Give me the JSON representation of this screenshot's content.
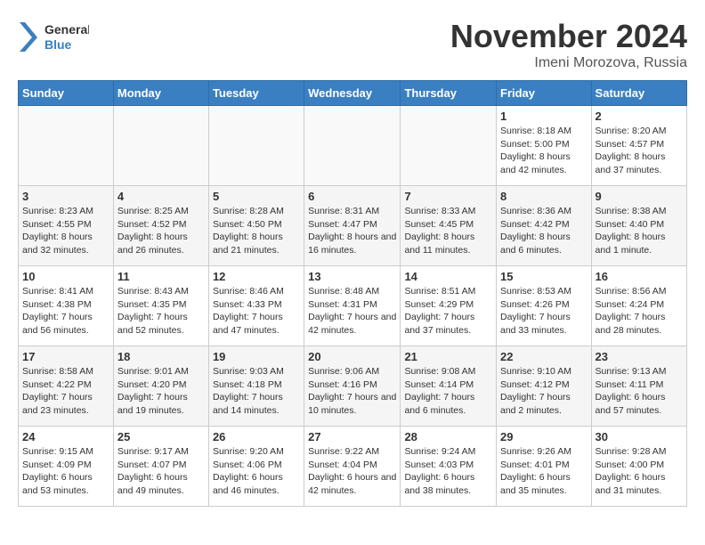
{
  "header": {
    "logo_general": "General",
    "logo_blue": "Blue",
    "month_title": "November 2024",
    "subtitle": "Imeni Morozova, Russia"
  },
  "weekdays": [
    "Sunday",
    "Monday",
    "Tuesday",
    "Wednesday",
    "Thursday",
    "Friday",
    "Saturday"
  ],
  "weeks": [
    [
      {
        "day": "",
        "info": ""
      },
      {
        "day": "",
        "info": ""
      },
      {
        "day": "",
        "info": ""
      },
      {
        "day": "",
        "info": ""
      },
      {
        "day": "",
        "info": ""
      },
      {
        "day": "1",
        "info": "Sunrise: 8:18 AM\nSunset: 5:00 PM\nDaylight: 8 hours and 42 minutes."
      },
      {
        "day": "2",
        "info": "Sunrise: 8:20 AM\nSunset: 4:57 PM\nDaylight: 8 hours and 37 minutes."
      }
    ],
    [
      {
        "day": "3",
        "info": "Sunrise: 8:23 AM\nSunset: 4:55 PM\nDaylight: 8 hours and 32 minutes."
      },
      {
        "day": "4",
        "info": "Sunrise: 8:25 AM\nSunset: 4:52 PM\nDaylight: 8 hours and 26 minutes."
      },
      {
        "day": "5",
        "info": "Sunrise: 8:28 AM\nSunset: 4:50 PM\nDaylight: 8 hours and 21 minutes."
      },
      {
        "day": "6",
        "info": "Sunrise: 8:31 AM\nSunset: 4:47 PM\nDaylight: 8 hours and 16 minutes."
      },
      {
        "day": "7",
        "info": "Sunrise: 8:33 AM\nSunset: 4:45 PM\nDaylight: 8 hours and 11 minutes."
      },
      {
        "day": "8",
        "info": "Sunrise: 8:36 AM\nSunset: 4:42 PM\nDaylight: 8 hours and 6 minutes."
      },
      {
        "day": "9",
        "info": "Sunrise: 8:38 AM\nSunset: 4:40 PM\nDaylight: 8 hours and 1 minute."
      }
    ],
    [
      {
        "day": "10",
        "info": "Sunrise: 8:41 AM\nSunset: 4:38 PM\nDaylight: 7 hours and 56 minutes."
      },
      {
        "day": "11",
        "info": "Sunrise: 8:43 AM\nSunset: 4:35 PM\nDaylight: 7 hours and 52 minutes."
      },
      {
        "day": "12",
        "info": "Sunrise: 8:46 AM\nSunset: 4:33 PM\nDaylight: 7 hours and 47 minutes."
      },
      {
        "day": "13",
        "info": "Sunrise: 8:48 AM\nSunset: 4:31 PM\nDaylight: 7 hours and 42 minutes."
      },
      {
        "day": "14",
        "info": "Sunrise: 8:51 AM\nSunset: 4:29 PM\nDaylight: 7 hours and 37 minutes."
      },
      {
        "day": "15",
        "info": "Sunrise: 8:53 AM\nSunset: 4:26 PM\nDaylight: 7 hours and 33 minutes."
      },
      {
        "day": "16",
        "info": "Sunrise: 8:56 AM\nSunset: 4:24 PM\nDaylight: 7 hours and 28 minutes."
      }
    ],
    [
      {
        "day": "17",
        "info": "Sunrise: 8:58 AM\nSunset: 4:22 PM\nDaylight: 7 hours and 23 minutes."
      },
      {
        "day": "18",
        "info": "Sunrise: 9:01 AM\nSunset: 4:20 PM\nDaylight: 7 hours and 19 minutes."
      },
      {
        "day": "19",
        "info": "Sunrise: 9:03 AM\nSunset: 4:18 PM\nDaylight: 7 hours and 14 minutes."
      },
      {
        "day": "20",
        "info": "Sunrise: 9:06 AM\nSunset: 4:16 PM\nDaylight: 7 hours and 10 minutes."
      },
      {
        "day": "21",
        "info": "Sunrise: 9:08 AM\nSunset: 4:14 PM\nDaylight: 7 hours and 6 minutes."
      },
      {
        "day": "22",
        "info": "Sunrise: 9:10 AM\nSunset: 4:12 PM\nDaylight: 7 hours and 2 minutes."
      },
      {
        "day": "23",
        "info": "Sunrise: 9:13 AM\nSunset: 4:11 PM\nDaylight: 6 hours and 57 minutes."
      }
    ],
    [
      {
        "day": "24",
        "info": "Sunrise: 9:15 AM\nSunset: 4:09 PM\nDaylight: 6 hours and 53 minutes."
      },
      {
        "day": "25",
        "info": "Sunrise: 9:17 AM\nSunset: 4:07 PM\nDaylight: 6 hours and 49 minutes."
      },
      {
        "day": "26",
        "info": "Sunrise: 9:20 AM\nSunset: 4:06 PM\nDaylight: 6 hours and 46 minutes."
      },
      {
        "day": "27",
        "info": "Sunrise: 9:22 AM\nSunset: 4:04 PM\nDaylight: 6 hours and 42 minutes."
      },
      {
        "day": "28",
        "info": "Sunrise: 9:24 AM\nSunset: 4:03 PM\nDaylight: 6 hours and 38 minutes."
      },
      {
        "day": "29",
        "info": "Sunrise: 9:26 AM\nSunset: 4:01 PM\nDaylight: 6 hours and 35 minutes."
      },
      {
        "day": "30",
        "info": "Sunrise: 9:28 AM\nSunset: 4:00 PM\nDaylight: 6 hours and 31 minutes."
      }
    ]
  ]
}
